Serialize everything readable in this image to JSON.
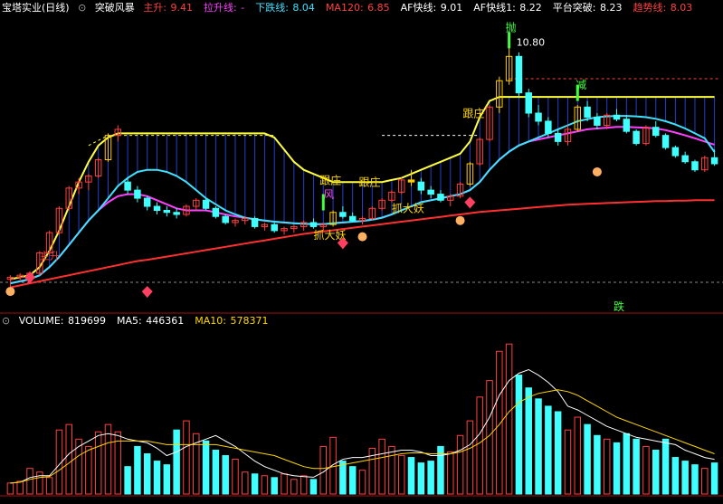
{
  "header": {
    "stock": "宝塔实业(日线)",
    "indicator": "突破风暴",
    "items": [
      {
        "label": "主升:",
        "value": "9.41",
        "color": "#ff4040"
      },
      {
        "label": "拉升线:",
        "value": "-",
        "color": "#ff40ff"
      },
      {
        "label": "下跌线:",
        "value": "8.04",
        "color": "#40e0ff"
      },
      {
        "label": "MA120:",
        "value": "6.85",
        "color": "#ff4040"
      },
      {
        "label": "AF快线:",
        "value": "9.01",
        "color": "#ffffff"
      },
      {
        "label": "AF快线1:",
        "value": "8.22",
        "color": "#ffffff"
      },
      {
        "label": "平台突破:",
        "value": "8.23",
        "color": "#ffffff"
      },
      {
        "label": "趋势线:",
        "value": "8.03",
        "color": "#ff4040"
      }
    ]
  },
  "volume_header": {
    "items": [
      {
        "label": "VOLUME:",
        "value": "819699",
        "color": "#ffffff"
      },
      {
        "label": "MA5:",
        "value": "446361",
        "color": "#ffffff"
      },
      {
        "label": "MA10:",
        "value": "578371",
        "color": "#ffd700"
      }
    ]
  },
  "annotations": {
    "peak_label": "10.80",
    "sell": "抛",
    "reduce": "减",
    "fall": "跌",
    "follow": "跟庄",
    "grab": "抓大妖",
    "storm": "风",
    "rise": "主升"
  },
  "colors": {
    "up": "#ff4040",
    "down": "#40ffff",
    "ma_fast": "#ffff40",
    "ma_mid": "#ff40ff",
    "ma_slow": "#ff2020",
    "trend": "#dd2020",
    "background": "#000000"
  },
  "chart_data": [
    {
      "type": "candlestick",
      "title": "宝塔实业(日线) 突破风暴",
      "ylim": [
        4.2,
        11.3
      ],
      "peak": 10.8,
      "candles": [
        [
          4.9,
          5.0,
          4.7,
          4.95
        ],
        [
          4.95,
          5.05,
          4.85,
          5.0
        ],
        [
          5.0,
          5.1,
          4.9,
          5.05
        ],
        [
          5.05,
          5.6,
          5.0,
          5.55
        ],
        [
          5.55,
          6.1,
          5.5,
          6.05
        ],
        [
          6.05,
          6.7,
          6.0,
          6.65
        ],
        [
          6.65,
          7.2,
          6.6,
          7.15
        ],
        [
          7.15,
          7.4,
          7.0,
          7.3
        ],
        [
          7.3,
          7.5,
          7.1,
          7.45
        ],
        [
          7.45,
          7.9,
          7.4,
          7.85
        ],
        [
          7.85,
          8.5,
          7.8,
          8.45
        ],
        [
          8.45,
          8.7,
          8.3,
          8.6
        ],
        [
          7.3,
          7.4,
          7.0,
          7.1
        ],
        [
          7.1,
          7.2,
          6.8,
          6.9
        ],
        [
          6.9,
          6.95,
          6.6,
          6.7
        ],
        [
          6.7,
          6.8,
          6.5,
          6.6
        ],
        [
          6.6,
          6.7,
          6.45,
          6.55
        ],
        [
          6.55,
          6.65,
          6.4,
          6.5
        ],
        [
          6.5,
          6.75,
          6.45,
          6.7
        ],
        [
          6.7,
          6.9,
          6.6,
          6.85
        ],
        [
          6.85,
          6.9,
          6.6,
          6.65
        ],
        [
          6.65,
          6.7,
          6.4,
          6.45
        ],
        [
          6.45,
          6.5,
          6.25,
          6.3
        ],
        [
          6.3,
          6.4,
          6.2,
          6.35
        ],
        [
          6.35,
          6.45,
          6.25,
          6.4
        ],
        [
          6.4,
          6.45,
          6.15,
          6.2
        ],
        [
          6.2,
          6.3,
          6.1,
          6.25
        ],
        [
          6.25,
          6.3,
          6.05,
          6.1
        ],
        [
          6.1,
          6.2,
          6.0,
          6.15
        ],
        [
          6.15,
          6.25,
          6.05,
          6.2
        ],
        [
          6.2,
          6.35,
          6.1,
          6.3
        ],
        [
          6.3,
          6.4,
          6.15,
          6.2
        ],
        [
          6.2,
          6.3,
          6.1,
          6.25
        ],
        [
          6.25,
          6.6,
          6.2,
          6.55
        ],
        [
          6.55,
          6.7,
          6.4,
          6.45
        ],
        [
          6.45,
          6.55,
          6.3,
          6.35
        ],
        [
          6.35,
          6.45,
          6.25,
          6.4
        ],
        [
          6.4,
          6.7,
          6.35,
          6.65
        ],
        [
          6.65,
          6.9,
          6.6,
          6.85
        ],
        [
          6.85,
          7.1,
          6.8,
          7.05
        ],
        [
          7.05,
          7.4,
          7.0,
          7.35
        ],
        [
          7.35,
          7.6,
          7.2,
          7.3
        ],
        [
          7.3,
          7.4,
          7.0,
          7.1
        ],
        [
          7.1,
          7.2,
          6.9,
          7.0
        ],
        [
          7.0,
          7.1,
          6.8,
          6.85
        ],
        [
          6.85,
          7.0,
          6.7,
          6.95
        ],
        [
          6.95,
          7.3,
          6.9,
          7.25
        ],
        [
          7.25,
          7.8,
          7.2,
          7.75
        ],
        [
          7.75,
          8.4,
          7.7,
          8.35
        ],
        [
          8.35,
          9.2,
          8.3,
          9.15
        ],
        [
          9.15,
          9.9,
          9.0,
          9.8
        ],
        [
          9.8,
          10.8,
          9.7,
          10.4
        ],
        [
          10.4,
          10.5,
          9.4,
          9.5
        ],
        [
          9.5,
          9.6,
          8.9,
          9.0
        ],
        [
          9.0,
          9.2,
          8.7,
          8.8
        ],
        [
          8.8,
          8.9,
          8.4,
          8.5
        ],
        [
          8.5,
          8.6,
          8.2,
          8.3
        ],
        [
          8.3,
          8.7,
          8.2,
          8.6
        ],
        [
          8.6,
          9.2,
          8.55,
          9.15
        ],
        [
          9.15,
          9.3,
          8.8,
          8.9
        ],
        [
          8.9,
          9.0,
          8.6,
          8.7
        ],
        [
          8.7,
          9.0,
          8.6,
          8.95
        ],
        [
          8.95,
          9.1,
          8.8,
          8.85
        ],
        [
          8.85,
          8.95,
          8.5,
          8.55
        ],
        [
          8.55,
          8.6,
          8.2,
          8.25
        ],
        [
          8.25,
          8.7,
          8.2,
          8.65
        ],
        [
          8.65,
          8.8,
          8.4,
          8.45
        ],
        [
          8.45,
          8.5,
          8.1,
          8.15
        ],
        [
          8.15,
          8.2,
          7.9,
          7.95
        ],
        [
          7.95,
          8.05,
          7.75,
          7.8
        ],
        [
          7.8,
          7.85,
          7.55,
          7.6
        ],
        [
          7.6,
          7.95,
          7.55,
          7.9
        ],
        [
          7.9,
          8.1,
          7.7,
          7.75
        ]
      ],
      "lines": [
        {
          "name": "主升",
          "color": "#ffff40",
          "values": [
            4.9,
            4.95,
            5.0,
            5.2,
            5.6,
            6.1,
            6.7,
            7.3,
            7.8,
            8.2,
            8.4,
            8.5,
            8.5,
            8.5,
            8.5,
            8.5,
            8.5,
            8.5,
            8.5,
            8.5,
            8.5,
            8.5,
            8.5,
            8.5,
            8.5,
            8.5,
            8.5,
            8.4,
            8.1,
            7.8,
            7.6,
            7.5,
            7.4,
            7.3,
            7.3,
            7.3,
            7.3,
            7.3,
            7.3,
            7.35,
            7.4,
            7.5,
            7.6,
            7.7,
            7.8,
            7.9,
            8.0,
            8.3,
            8.9,
            9.3,
            9.4,
            9.4,
            9.4,
            9.4,
            9.4,
            9.4,
            9.4,
            9.4,
            9.4,
            9.4,
            9.4,
            9.4,
            9.4,
            9.4,
            9.4,
            9.4,
            9.4,
            9.4,
            9.4,
            9.4,
            9.4,
            9.4,
            9.4
          ]
        },
        {
          "name": "拉升线",
          "color": "#ff40ff",
          "values": [
            4.8,
            4.85,
            4.9,
            5.0,
            5.2,
            5.45,
            5.75,
            6.05,
            6.35,
            6.6,
            6.8,
            6.95,
            7.0,
            7.0,
            6.95,
            6.85,
            6.75,
            6.65,
            6.6,
            6.6,
            6.6,
            6.55,
            6.5,
            6.45,
            6.42,
            6.38,
            6.35,
            6.32,
            6.3,
            6.28,
            6.27,
            6.26,
            6.26,
            6.28,
            6.3,
            6.32,
            6.34,
            6.37,
            6.42,
            6.5,
            6.6,
            6.7,
            6.8,
            6.85,
            6.9,
            6.95,
            7.0,
            7.1,
            7.3,
            7.6,
            7.85,
            8.05,
            8.2,
            8.3,
            8.35,
            8.4,
            8.45,
            8.5,
            8.55,
            8.6,
            8.62,
            8.64,
            8.66,
            8.66,
            8.65,
            8.64,
            8.62,
            8.58,
            8.52,
            8.45,
            8.38,
            8.3,
            8.22
          ]
        },
        {
          "name": "下跌线",
          "color": "#40e0ff",
          "values": [
            4.8,
            4.85,
            4.9,
            5.0,
            5.2,
            5.45,
            5.75,
            6.05,
            6.35,
            6.6,
            6.9,
            7.2,
            7.4,
            7.55,
            7.6,
            7.6,
            7.55,
            7.45,
            7.3,
            7.1,
            6.9,
            6.75,
            6.6,
            6.5,
            6.42,
            6.38,
            6.35,
            6.32,
            6.3,
            6.28,
            6.27,
            6.26,
            6.26,
            6.28,
            6.3,
            6.32,
            6.34,
            6.37,
            6.42,
            6.5,
            6.6,
            6.7,
            6.8,
            6.85,
            6.9,
            6.95,
            7.0,
            7.1,
            7.3,
            7.6,
            7.85,
            8.05,
            8.2,
            8.3,
            8.4,
            8.5,
            8.6,
            8.7,
            8.8,
            8.85,
            8.9,
            8.92,
            8.93,
            8.93,
            8.92,
            8.9,
            8.86,
            8.8,
            8.72,
            8.62,
            8.5,
            8.38,
            8.04
          ]
        },
        {
          "name": "MA120",
          "color": "#ff3030",
          "values": [
            4.7,
            4.75,
            4.8,
            4.85,
            4.9,
            4.95,
            5.0,
            5.05,
            5.1,
            5.15,
            5.2,
            5.25,
            5.3,
            5.35,
            5.38,
            5.42,
            5.46,
            5.5,
            5.54,
            5.58,
            5.62,
            5.66,
            5.7,
            5.74,
            5.78,
            5.82,
            5.86,
            5.9,
            5.94,
            5.98,
            6.02,
            6.05,
            6.08,
            6.11,
            6.14,
            6.17,
            6.2,
            6.23,
            6.26,
            6.29,
            6.32,
            6.35,
            6.38,
            6.41,
            6.44,
            6.47,
            6.5,
            6.53,
            6.56,
            6.58,
            6.6,
            6.62,
            6.64,
            6.66,
            6.68,
            6.7,
            6.72,
            6.74,
            6.75,
            6.76,
            6.77,
            6.78,
            6.79,
            6.8,
            6.81,
            6.82,
            6.83,
            6.83,
            6.84,
            6.84,
            6.85,
            6.85,
            6.85
          ]
        }
      ]
    },
    {
      "type": "bar",
      "title": "VOLUME",
      "ylim": [
        0,
        900000
      ],
      "series": [
        {
          "name": "VOLUME",
          "values": [
            60000,
            70000,
            140000,
            120000,
            90000,
            350000,
            380000,
            300000,
            260000,
            340000,
            380000,
            340000,
            150000,
            260000,
            220000,
            180000,
            160000,
            350000,
            400000,
            330000,
            290000,
            240000,
            210000,
            190000,
            120000,
            110000,
            100000,
            90000,
            110000,
            80000,
            100000,
            80000,
            260000,
            310000,
            180000,
            150000,
            130000,
            250000,
            300000,
            260000,
            210000,
            200000,
            170000,
            180000,
            260000,
            230000,
            320000,
            400000,
            530000,
            620000,
            780000,
            820000,
            650000,
            580000,
            520000,
            480000,
            450000,
            350000,
            420000,
            380000,
            320000,
            300000,
            280000,
            330000,
            300000,
            260000,
            240000,
            300000,
            200000,
            180000,
            160000,
            140000,
            170000
          ]
        },
        {
          "name": "MA5",
          "values": [
            60000,
            65000,
            90000,
            100000,
            100000,
            160000,
            220000,
            260000,
            290000,
            320000,
            330000,
            320000,
            300000,
            290000,
            280000,
            250000,
            210000,
            230000,
            260000,
            280000,
            300000,
            320000,
            290000,
            260000,
            220000,
            180000,
            150000,
            130000,
            110000,
            100000,
            95000,
            92000,
            120000,
            160000,
            190000,
            200000,
            200000,
            210000,
            220000,
            230000,
            240000,
            240000,
            230000,
            210000,
            210000,
            220000,
            240000,
            270000,
            330000,
            420000,
            540000,
            620000,
            660000,
            680000,
            650000,
            610000,
            560000,
            480000,
            460000,
            430000,
            400000,
            370000,
            350000,
            330000,
            310000,
            300000,
            290000,
            280000,
            270000,
            240000,
            220000,
            200000,
            190000
          ]
        },
        {
          "name": "MA10",
          "values": [
            60000,
            65000,
            80000,
            90000,
            95000,
            130000,
            170000,
            210000,
            240000,
            260000,
            280000,
            290000,
            290000,
            290000,
            290000,
            280000,
            270000,
            270000,
            270000,
            270000,
            270000,
            270000,
            260000,
            250000,
            240000,
            230000,
            220000,
            210000,
            190000,
            170000,
            150000,
            140000,
            140000,
            150000,
            160000,
            170000,
            180000,
            190000,
            200000,
            210000,
            220000,
            225000,
            225000,
            220000,
            220000,
            220000,
            230000,
            250000,
            280000,
            320000,
            380000,
            450000,
            500000,
            530000,
            550000,
            560000,
            570000,
            560000,
            540000,
            510000,
            480000,
            450000,
            420000,
            400000,
            380000,
            360000,
            340000,
            320000,
            300000,
            280000,
            260000,
            240000,
            220000
          ]
        }
      ]
    }
  ]
}
